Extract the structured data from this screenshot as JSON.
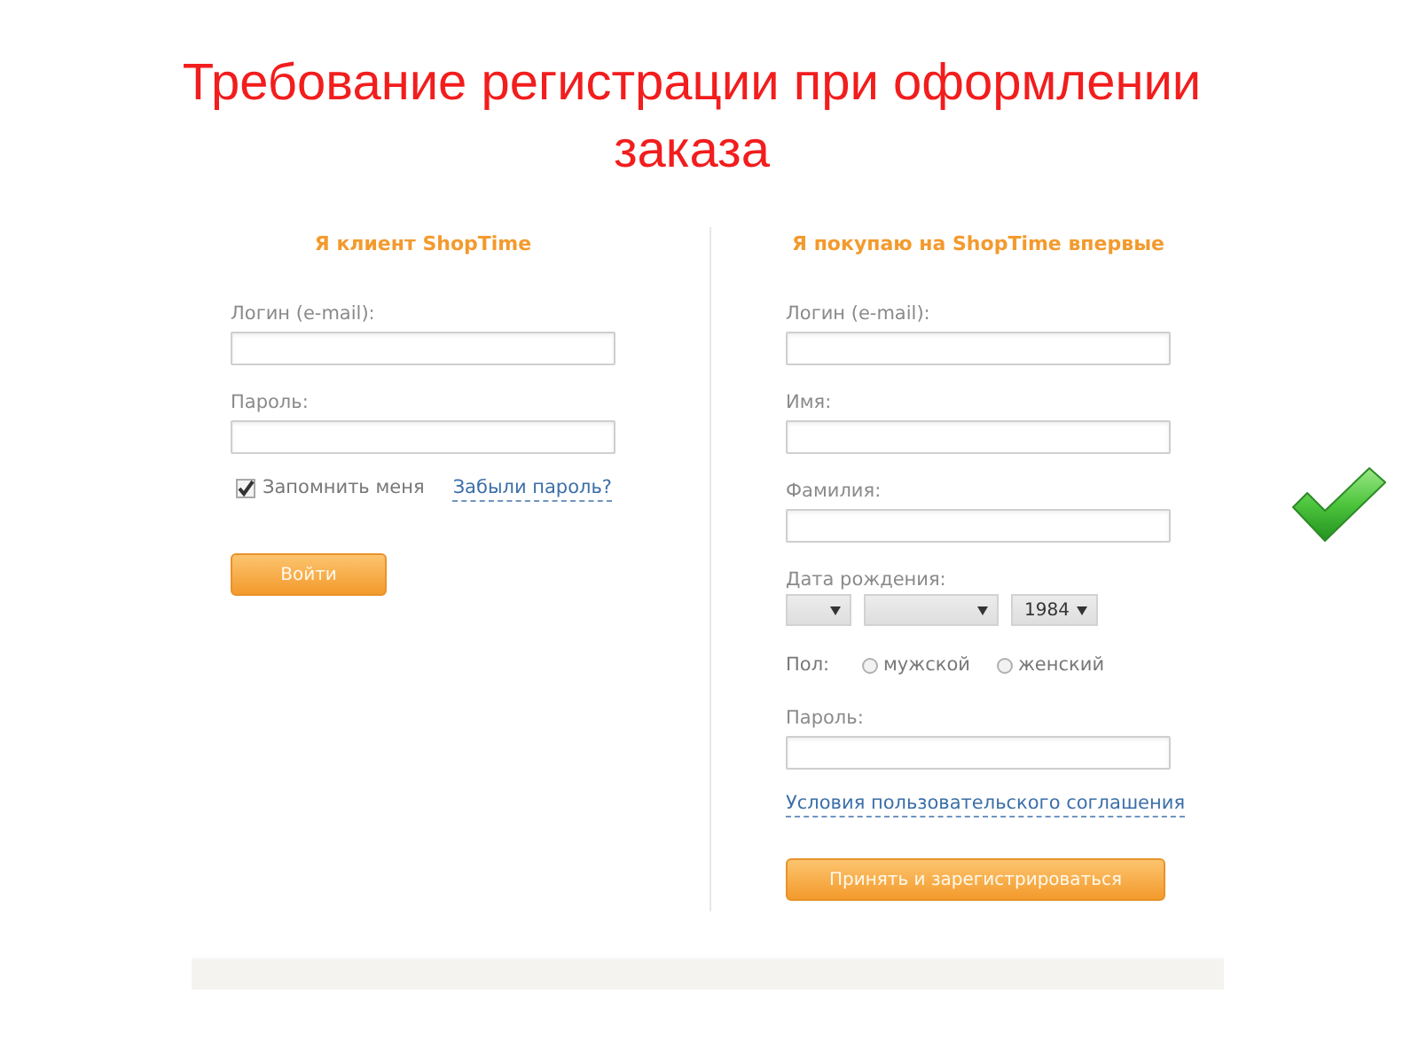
{
  "slide_title": "Требование регистрации при оформлении заказа",
  "login_panel": {
    "heading": "Я клиент ShopTime",
    "fields": [
      {
        "label": "Логин (e-mail):"
      },
      {
        "label": "Пароль:"
      }
    ],
    "remember": {
      "label": "Запомнить меня",
      "checked": true
    },
    "forgot_link": "Забыли пароль?",
    "submit": "Войти"
  },
  "register_panel": {
    "heading": "Я покупаю на ShopTime впервые",
    "rows": [
      {
        "kind": "text",
        "label": "Логин (e-mail):"
      },
      {
        "kind": "text",
        "label": "Имя:"
      },
      {
        "kind": "text",
        "label": "Фамилия:"
      },
      {
        "kind": "date",
        "label": "Дата рождения:",
        "selects": [
          {
            "kind": "day"
          },
          {
            "kind": "month"
          },
          {
            "kind": "year",
            "value": "1984"
          }
        ]
      },
      {
        "kind": "radio",
        "label": "Пол:",
        "options": [
          {
            "label": "мужской",
            "selected": false
          },
          {
            "label": "женский",
            "selected": false
          }
        ]
      },
      {
        "kind": "text",
        "label": "Пароль:"
      }
    ],
    "terms_link": "Условия пользовательского соглашения",
    "submit": "Принять и зарегистрироваться"
  }
}
